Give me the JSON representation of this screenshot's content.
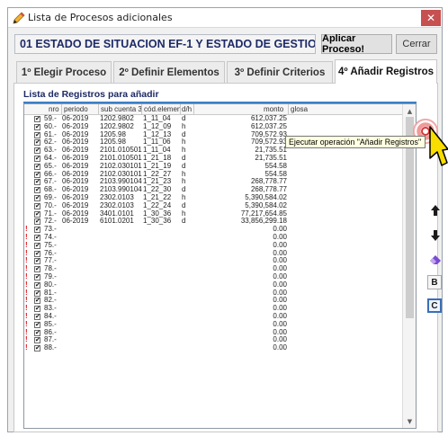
{
  "window": {
    "title": "Lista de Procesos adicionales",
    "close_glyph": "✕"
  },
  "process": {
    "name": "01 ESTADO DE SITUACION EF-1 Y ESTADO DE GESTION EF-2",
    "apply_label": "Aplicar Proceso!",
    "close_label": "Cerrar"
  },
  "tabs": [
    {
      "label": "1º Elegir Proceso"
    },
    {
      "label": "2º Definir Elementos"
    },
    {
      "label": "3º Definir Criterios"
    },
    {
      "label": "4º Añadir Registros"
    }
  ],
  "active_tab": 3,
  "grid": {
    "title": "Lista de Registros para añadir",
    "headers": {
      "nro": "nro",
      "periodo": "periodo",
      "sub_cuenta": "sub cuenta 3",
      "cod_elemento": "cód.elemen",
      "dh": "d/h",
      "monto": "monto",
      "glosa": "glosa"
    },
    "rows": [
      {
        "warn": false,
        "checked": true,
        "nro": "59.-",
        "periodo": "06-2019",
        "sub_cuenta": "1202.9802",
        "cod": "1_11_04",
        "dh": "d",
        "monto": "612,037.25"
      },
      {
        "warn": false,
        "checked": true,
        "nro": "60.-",
        "periodo": "06-2019",
        "sub_cuenta": "1202.9802",
        "cod": "1_12_09",
        "dh": "h",
        "monto": "612,037.25"
      },
      {
        "warn": false,
        "checked": true,
        "nro": "61.-",
        "periodo": "06-2019",
        "sub_cuenta": "1205.98",
        "cod": "1_12_13",
        "dh": "d",
        "monto": "709,572.93"
      },
      {
        "warn": false,
        "checked": true,
        "nro": "62.-",
        "periodo": "06-2019",
        "sub_cuenta": "1205.98",
        "cod": "1_11_06",
        "dh": "h",
        "monto": "709,572.93"
      },
      {
        "warn": false,
        "checked": true,
        "nro": "63.-",
        "periodo": "06-2019",
        "sub_cuenta": "2101.010501",
        "cod": "1_11_04",
        "dh": "h",
        "monto": "21,735.51"
      },
      {
        "warn": false,
        "checked": true,
        "nro": "64.-",
        "periodo": "06-2019",
        "sub_cuenta": "2101.010501",
        "cod": "1_21_18",
        "dh": "d",
        "monto": "21,735.51"
      },
      {
        "warn": false,
        "checked": true,
        "nro": "65.-",
        "periodo": "06-2019",
        "sub_cuenta": "2102.030101",
        "cod": "1_21_19",
        "dh": "d",
        "monto": "554.58"
      },
      {
        "warn": false,
        "checked": true,
        "nro": "66.-",
        "periodo": "06-2019",
        "sub_cuenta": "2102.030101",
        "cod": "1_22_27",
        "dh": "h",
        "monto": "554.58"
      },
      {
        "warn": false,
        "checked": true,
        "nro": "67.-",
        "periodo": "06-2019",
        "sub_cuenta": "2103.990104",
        "cod": "1_21_23",
        "dh": "h",
        "monto": "268,778.77"
      },
      {
        "warn": false,
        "checked": true,
        "nro": "68.-",
        "periodo": "06-2019",
        "sub_cuenta": "2103.990104",
        "cod": "1_22_30",
        "dh": "d",
        "monto": "268,778.77"
      },
      {
        "warn": false,
        "checked": true,
        "nro": "69.-",
        "periodo": "06-2019",
        "sub_cuenta": "2302.0103",
        "cod": "1_21_22",
        "dh": "h",
        "monto": "5,390,584.02"
      },
      {
        "warn": false,
        "checked": true,
        "nro": "70.-",
        "periodo": "06-2019",
        "sub_cuenta": "2302.0103",
        "cod": "1_22_24",
        "dh": "d",
        "monto": "5,390,584.02"
      },
      {
        "warn": false,
        "checked": true,
        "nro": "71.-",
        "periodo": "06-2019",
        "sub_cuenta": "3401.0101",
        "cod": "1_30_36",
        "dh": "h",
        "monto": "77,217,654.85"
      },
      {
        "warn": false,
        "checked": true,
        "nro": "72.-",
        "periodo": "06-2019",
        "sub_cuenta": "6101.0201",
        "cod": "1_30_36",
        "dh": "d",
        "monto": "33,856,299.18"
      },
      {
        "warn": true,
        "checked": true,
        "nro": "73.-",
        "periodo": "",
        "sub_cuenta": "",
        "cod": "",
        "dh": "",
        "monto": "0.00"
      },
      {
        "warn": true,
        "checked": true,
        "nro": "74.-",
        "periodo": "",
        "sub_cuenta": "",
        "cod": "",
        "dh": "",
        "monto": "0.00"
      },
      {
        "warn": true,
        "checked": true,
        "nro": "75.-",
        "periodo": "",
        "sub_cuenta": "",
        "cod": "",
        "dh": "",
        "monto": "0.00"
      },
      {
        "warn": true,
        "checked": true,
        "nro": "76.-",
        "periodo": "",
        "sub_cuenta": "",
        "cod": "",
        "dh": "",
        "monto": "0.00"
      },
      {
        "warn": true,
        "checked": true,
        "nro": "77.-",
        "periodo": "",
        "sub_cuenta": "",
        "cod": "",
        "dh": "",
        "monto": "0.00"
      },
      {
        "warn": true,
        "checked": true,
        "nro": "78.-",
        "periodo": "",
        "sub_cuenta": "",
        "cod": "",
        "dh": "",
        "monto": "0.00"
      },
      {
        "warn": true,
        "checked": true,
        "nro": "79.-",
        "periodo": "",
        "sub_cuenta": "",
        "cod": "",
        "dh": "",
        "monto": "0.00"
      },
      {
        "warn": true,
        "checked": true,
        "nro": "80.-",
        "periodo": "",
        "sub_cuenta": "",
        "cod": "",
        "dh": "",
        "monto": "0.00"
      },
      {
        "warn": true,
        "checked": true,
        "nro": "81.-",
        "periodo": "",
        "sub_cuenta": "",
        "cod": "",
        "dh": "",
        "monto": "0.00"
      },
      {
        "warn": true,
        "checked": true,
        "nro": "82.-",
        "periodo": "",
        "sub_cuenta": "",
        "cod": "",
        "dh": "",
        "monto": "0.00"
      },
      {
        "warn": true,
        "checked": true,
        "nro": "83.-",
        "periodo": "",
        "sub_cuenta": "",
        "cod": "",
        "dh": "",
        "monto": "0.00"
      },
      {
        "warn": true,
        "checked": true,
        "nro": "84.-",
        "periodo": "",
        "sub_cuenta": "",
        "cod": "",
        "dh": "",
        "monto": "0.00"
      },
      {
        "warn": true,
        "checked": true,
        "nro": "85.-",
        "periodo": "",
        "sub_cuenta": "",
        "cod": "",
        "dh": "",
        "monto": "0.00"
      },
      {
        "warn": true,
        "checked": true,
        "nro": "86.-",
        "periodo": "",
        "sub_cuenta": "",
        "cod": "",
        "dh": "",
        "monto": "0.00"
      },
      {
        "warn": true,
        "checked": true,
        "nro": "87.-",
        "periodo": "",
        "sub_cuenta": "",
        "cod": "",
        "dh": "",
        "monto": "0.00"
      },
      {
        "warn": true,
        "checked": true,
        "nro": "88.-",
        "periodo": "",
        "sub_cuenta": "",
        "cod": "",
        "dh": "",
        "monto": "0.00"
      }
    ],
    "warn_glyph": "!",
    "check_glyph": "✔"
  },
  "side_buttons": {
    "up_glyph": "🡅",
    "down_glyph": "🡇",
    "eraser_icon": "eraser-icon",
    "b_label": "B",
    "c_label": "C"
  },
  "tooltip": {
    "text": "Ejecutar operación \"Añadir Registros\""
  },
  "colors": {
    "accent": "#3d7fc4",
    "title_text": "#1d2a66",
    "warn": "#e0141b",
    "close": "#c75050",
    "tooltip_bg": "#ffffe1"
  }
}
